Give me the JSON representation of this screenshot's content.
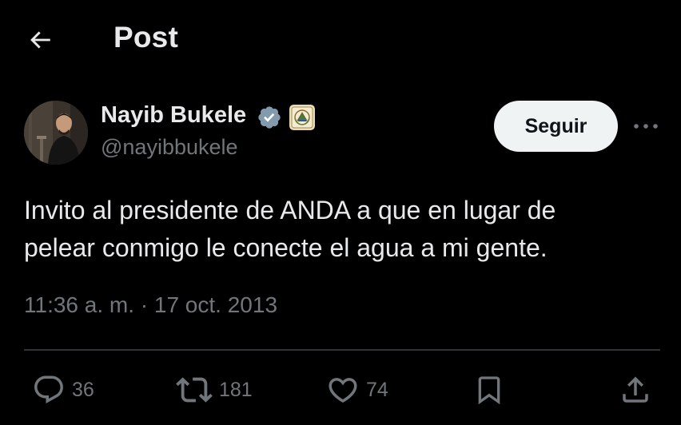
{
  "header": {
    "title": "Post",
    "back_icon": "arrow-left-icon"
  },
  "author": {
    "name": "Nayib Bukele",
    "handle": "@nayibbukele",
    "verified_color": "#829aab",
    "verified_icon": "verified-badge-icon",
    "affiliate_icon": "el-salvador-emblem-icon"
  },
  "follow_button": {
    "label": "Seguir"
  },
  "more_icon": "more-horizontal-icon",
  "tweet": {
    "text_line1": "Invito al presidente de ANDA a que en lugar de",
    "text_line2": "pelear conmigo le conecte el agua a mi gente.",
    "timestamp": "11:36 a. m. · 17 oct. 2013"
  },
  "actions": {
    "replies": "36",
    "reposts": "181",
    "likes": "74",
    "reply_icon": "reply-icon",
    "repost_icon": "repost-icon",
    "like_icon": "heart-icon",
    "bookmark_icon": "bookmark-icon",
    "share_icon": "share-icon"
  },
  "colors": {
    "background": "#000000",
    "text_primary": "#e7e9ea",
    "text_secondary": "#71767b",
    "divider": "#2f3336",
    "follow_button_bg": "#eff3f4",
    "follow_button_text": "#0f1419"
  }
}
